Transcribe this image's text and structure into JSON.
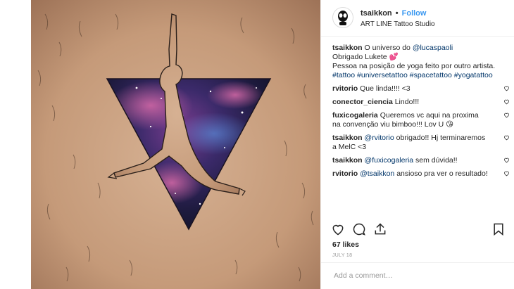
{
  "post": {
    "header": {
      "username": "tsaikkon",
      "separator": "•",
      "follow_label": "Follow",
      "location": "ART LINE Tattoo Studio"
    },
    "caption": {
      "username": "tsaikkon",
      "text1": "O universo do ",
      "mention": "@lucaspaoli",
      "line2": "Obrigado Lukete",
      "emoji": "💕",
      "line3": "Pessoa na posição de yoga feito por outro artista.",
      "hashtags": "#tattoo #universetattoo #spacetattoo #yogatattoo"
    },
    "comments": [
      {
        "user": "rvitorio",
        "text": "Que linda!!!! <3"
      },
      {
        "user": "conector_ciencia",
        "text": "Lindo!!!"
      },
      {
        "user": "fuxicogaleria",
        "text": "Queremos vc aqui na proxima na convenção viu bimboo!!! Lov U 😘"
      },
      {
        "user": "tsaikkon",
        "mention": "@rvitorio",
        "text": " obrigado!! Hj terminaremos a MelC <3"
      },
      {
        "user": "tsaikkon",
        "mention": "@fuxicogaleria",
        "text": " sem dúvida!!"
      },
      {
        "user": "rvitorio",
        "mention": "@tsaikkon",
        "text": " ansioso pra ver o resultado!"
      }
    ],
    "likes": "67 likes",
    "date": "JULY 18",
    "add_comment_placeholder": "Add a comment…"
  },
  "icons": {
    "like": "heart-icon",
    "comment": "comment-icon",
    "share": "share-icon",
    "save": "bookmark-icon",
    "comment_like": "heart-icon"
  },
  "colors": {
    "link": "#003569",
    "follow": "#3897f0",
    "muted": "#999999"
  }
}
